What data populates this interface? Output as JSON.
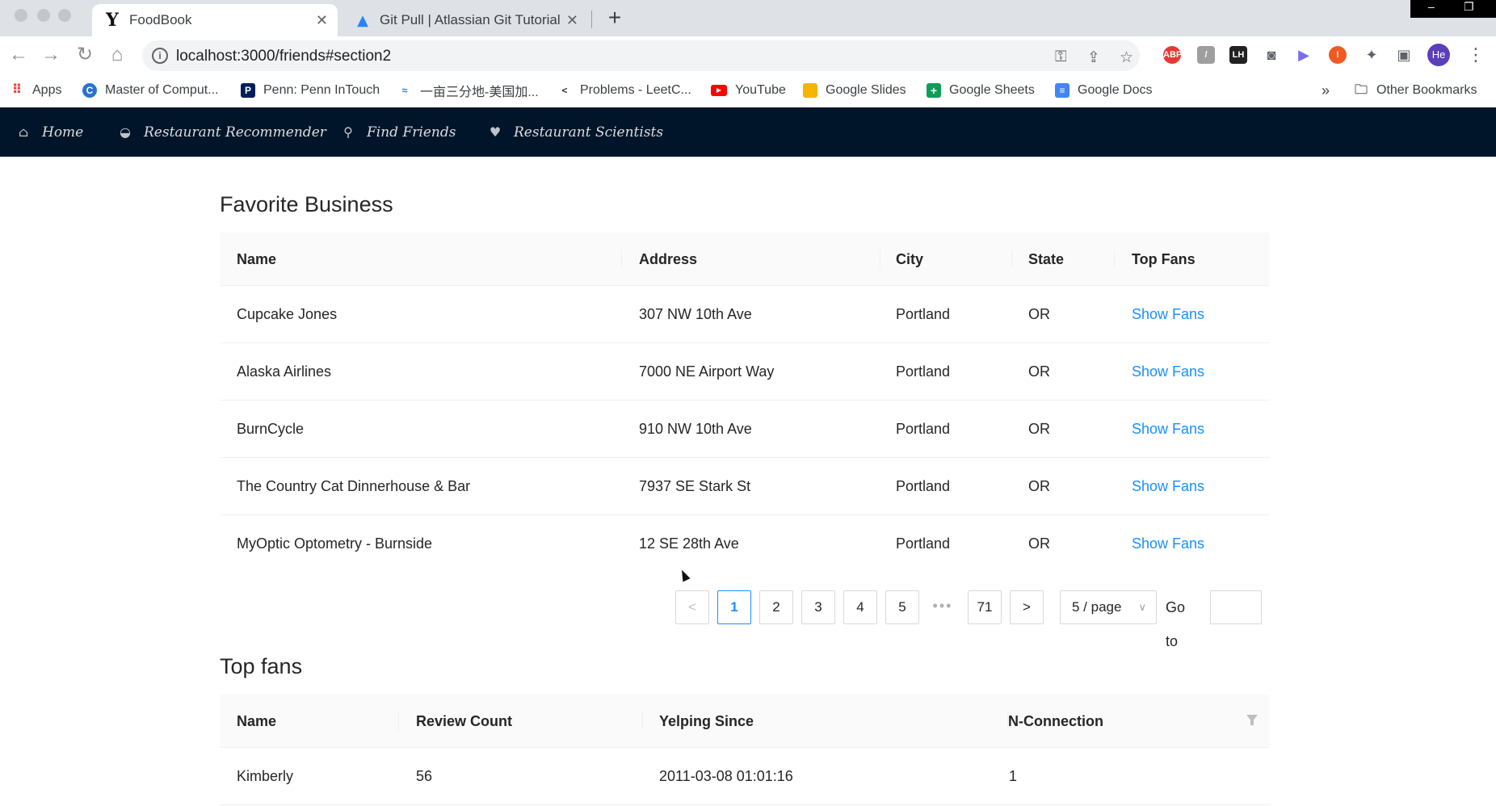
{
  "browser": {
    "tabs": [
      {
        "title": "FoodBook",
        "icon": "Y",
        "close": "✕"
      },
      {
        "title": "Git Pull | Atlassian Git Tutorial",
        "icon": "▲",
        "close": "✕"
      }
    ],
    "new_tab": "+",
    "url": "localhost:3000/friends#section2",
    "profile_initials": "He",
    "bookmarks": [
      {
        "label": "Apps",
        "icon": "apps-grid-icon"
      },
      {
        "label": "Master of Comput...",
        "icon": "coursera-icon"
      },
      {
        "label": "Penn: Penn InTouch",
        "icon": "penn-shield-icon"
      },
      {
        "label": "一亩三分地-美国加...",
        "icon": "1point3acres-icon"
      },
      {
        "label": "Problems - LeetC...",
        "icon": "leetcode-icon"
      },
      {
        "label": "YouTube",
        "icon": "youtube-icon"
      },
      {
        "label": "Google Slides",
        "icon": "google-slides-icon"
      },
      {
        "label": "Google Sheets",
        "icon": "google-sheets-icon"
      },
      {
        "label": "Google Docs",
        "icon": "google-docs-icon"
      }
    ],
    "bookmarks_overflow": "»",
    "other_bookmarks": "Other Bookmarks"
  },
  "nav": {
    "items": [
      {
        "label": "Home",
        "icon": "home-icon"
      },
      {
        "label": "Restaurant Recommender",
        "icon": "bowl-icon"
      },
      {
        "label": "Find Friends",
        "icon": "user-search-icon"
      },
      {
        "label": "Restaurant Scientists",
        "icon": "heart-circle-icon"
      }
    ],
    "bg_color": "#001529"
  },
  "favorite_business": {
    "title": "Favorite Business",
    "columns": [
      "Name",
      "Address",
      "City",
      "State",
      "Top Fans"
    ],
    "rows": [
      {
        "name": "Cupcake Jones",
        "address": "307 NW 10th Ave",
        "city": "Portland",
        "state": "OR",
        "action": "Show Fans"
      },
      {
        "name": "Alaska Airlines",
        "address": "7000 NE Airport Way",
        "city": "Portland",
        "state": "OR",
        "action": "Show Fans"
      },
      {
        "name": "BurnCycle",
        "address": "910 NW 10th Ave",
        "city": "Portland",
        "state": "OR",
        "action": "Show Fans"
      },
      {
        "name": "The Country Cat Dinnerhouse & Bar",
        "address": "7937 SE Stark St",
        "city": "Portland",
        "state": "OR",
        "action": "Show Fans"
      },
      {
        "name": "MyOptic Optometry - Burnside",
        "address": "12 SE 28th Ave",
        "city": "Portland",
        "state": "OR",
        "action": "Show Fans"
      }
    ],
    "link_color": "#1890ff",
    "pagination": {
      "prev": "<",
      "pages": [
        "1",
        "2",
        "3",
        "4",
        "5"
      ],
      "current": "1",
      "ellipsis": "•••",
      "last": "71",
      "next": ">",
      "page_size": "5 / page",
      "goto_label": "Go to",
      "goto_value": ""
    }
  },
  "top_fans": {
    "title": "Top fans",
    "columns": [
      "Name",
      "Review Count",
      "Yelping Since",
      "N-Connection"
    ],
    "rows": [
      {
        "name": "Kimberly",
        "review_count": "56",
        "yelping_since": "2011-03-08 01:01:16",
        "n_connection": "1"
      }
    ]
  }
}
